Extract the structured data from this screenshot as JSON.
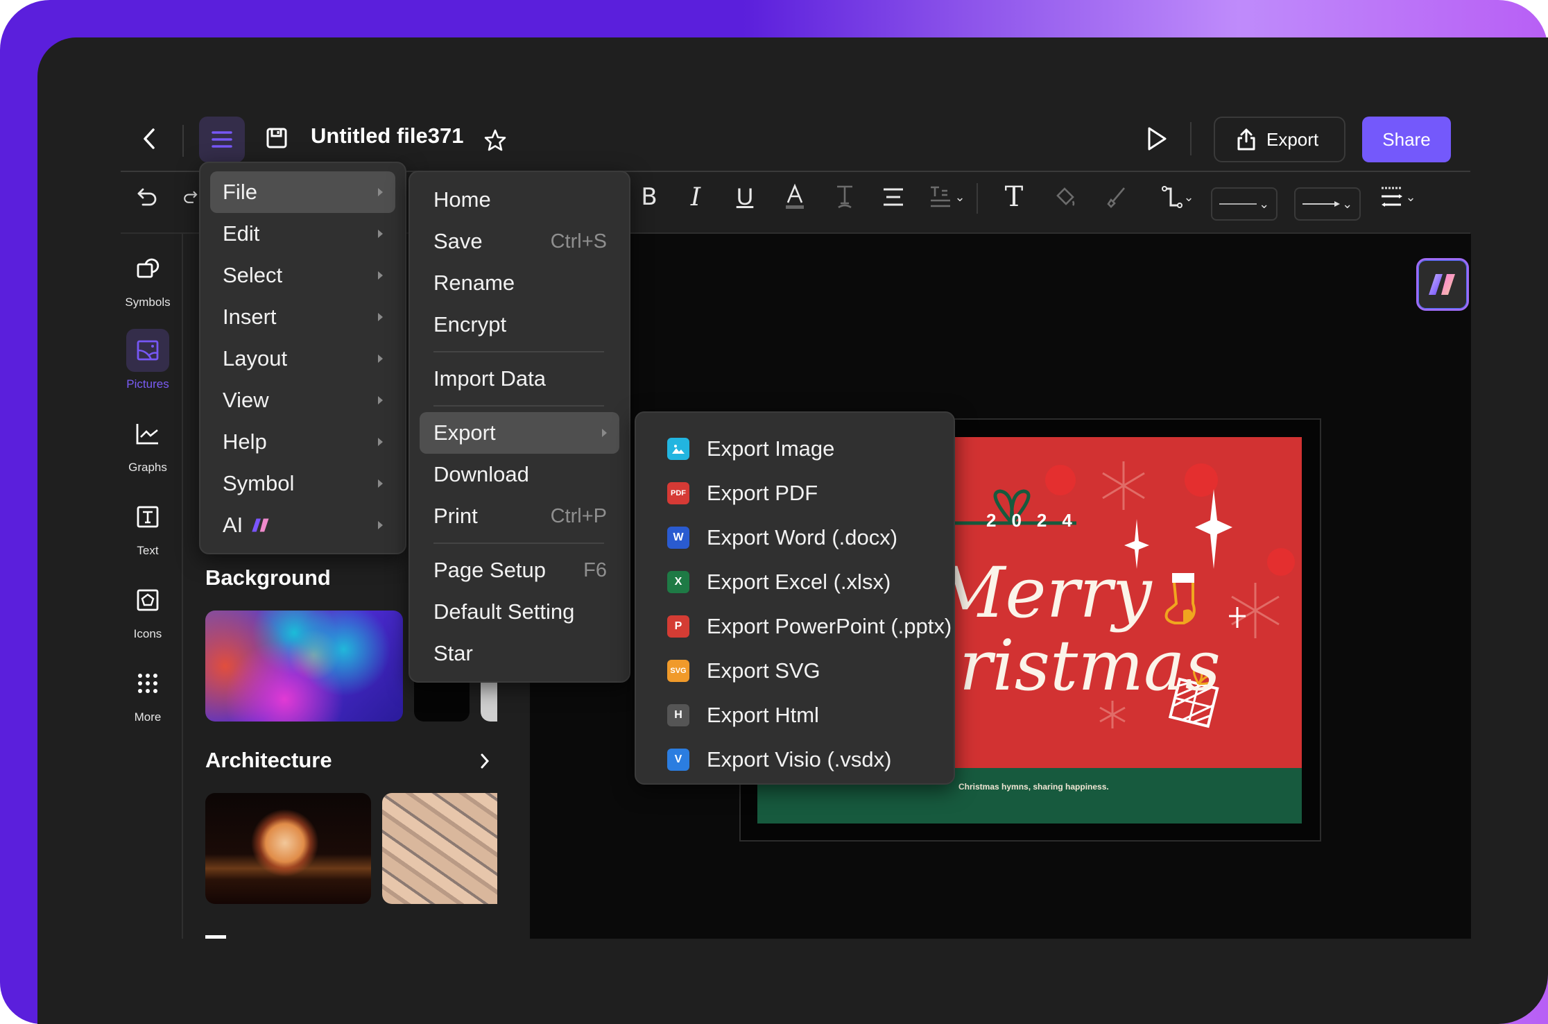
{
  "header": {
    "title": "Untitled file371",
    "export_label": "Export",
    "share_label": "Share",
    "icons": [
      "back-icon",
      "hamburger-menu-icon",
      "save-icon",
      "star-icon",
      "play-icon",
      "export-upload-icon"
    ]
  },
  "colors": {
    "accent": "#7459fb",
    "frame_gradient_start": "#5b1fdc",
    "frame_gradient_end": "#b85ff5",
    "panel_bg": "#1f1f1f",
    "menu_bg": "#303030",
    "menu_highlight": "#4f4f4f"
  },
  "toolbar": {
    "tools": [
      "undo",
      "redo",
      "bold",
      "italic",
      "underline",
      "font-color",
      "text-style",
      "align",
      "text-spacing",
      "text",
      "fill",
      "brush",
      "connector",
      "line-style",
      "arrow-style",
      "line-dash"
    ],
    "labels": {
      "bold": "B",
      "italic": "I",
      "underline": "U",
      "font_color": "A",
      "text": "T"
    }
  },
  "rail": {
    "items": [
      {
        "label": "Symbols",
        "icon": "symbols-icon",
        "active": false
      },
      {
        "label": "Pictures",
        "icon": "pictures-icon",
        "active": true
      },
      {
        "label": "Graphs",
        "icon": "graphs-icon",
        "active": false
      },
      {
        "label": "Text",
        "icon": "text-icon",
        "active": false
      },
      {
        "label": "Icons",
        "icon": "icons-icon",
        "active": false
      },
      {
        "label": "More",
        "icon": "more-icon",
        "active": false
      }
    ]
  },
  "side_panel": {
    "sections": [
      {
        "title": "Background"
      },
      {
        "title": "Architecture"
      }
    ]
  },
  "main_menu": {
    "items": [
      {
        "label": "File",
        "highlighted": true
      },
      {
        "label": "Edit"
      },
      {
        "label": "Select"
      },
      {
        "label": "Insert"
      },
      {
        "label": "Layout"
      },
      {
        "label": "View"
      },
      {
        "label": "Help"
      },
      {
        "label": "Symbol"
      },
      {
        "label": "AI"
      }
    ]
  },
  "file_menu": {
    "items": [
      {
        "label": "Home",
        "shortcut": ""
      },
      {
        "label": "Save",
        "shortcut": "Ctrl+S"
      },
      {
        "label": "Rename",
        "shortcut": ""
      },
      {
        "label": "Encrypt",
        "shortcut": ""
      },
      {
        "label": "Import Data",
        "shortcut": ""
      },
      {
        "label": "Export",
        "shortcut": ""
      },
      {
        "label": "Download",
        "shortcut": ""
      },
      {
        "label": "Print",
        "shortcut": "Ctrl+P"
      },
      {
        "label": "Page Setup",
        "shortcut": "F6"
      },
      {
        "label": "Default Setting",
        "shortcut": ""
      },
      {
        "label": "Star",
        "shortcut": ""
      }
    ]
  },
  "export_menu": {
    "items": [
      {
        "label": "Export Image",
        "badge": "",
        "color": "#22b5e0"
      },
      {
        "label": "Export PDF",
        "badge": "PDF",
        "color": "#d63a35"
      },
      {
        "label": "Export Word (.docx)",
        "badge": "W",
        "color": "#2a5bd0"
      },
      {
        "label": "Export Excel (.xlsx)",
        "badge": "X",
        "color": "#1e7a45"
      },
      {
        "label": "Export PowerPoint (.pptx)",
        "badge": "P",
        "color": "#d43c34"
      },
      {
        "label": "Export SVG",
        "badge": "SVG",
        "color": "#f09a2a"
      },
      {
        "label": "Export Html",
        "badge": "H",
        "color": "#555555"
      },
      {
        "label": "Export Visio (.vsdx)",
        "badge": "V",
        "color": "#2b7de0"
      }
    ]
  },
  "canvas": {
    "card": {
      "year": "2024",
      "title_line1": "Merry",
      "title_line2": "Christmas",
      "tagline": "Christmas hymns, sharing happiness.",
      "bg_color": "#d23232",
      "footer_color": "#175a3e"
    }
  }
}
